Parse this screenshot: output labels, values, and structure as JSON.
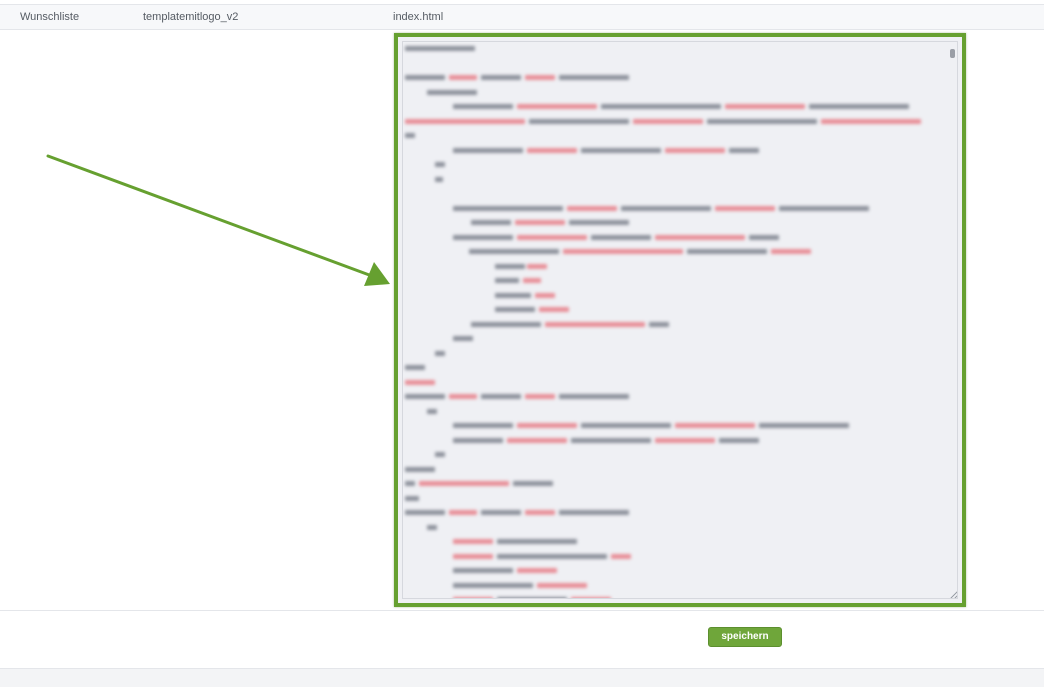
{
  "row": {
    "name": "Wunschliste",
    "template": "templatemitlogo_v2",
    "file": "index.html"
  },
  "footer": {
    "save_label": "speichern"
  },
  "colors": {
    "accent_green": "#66a030",
    "button_green": "#6fa63a"
  }
}
